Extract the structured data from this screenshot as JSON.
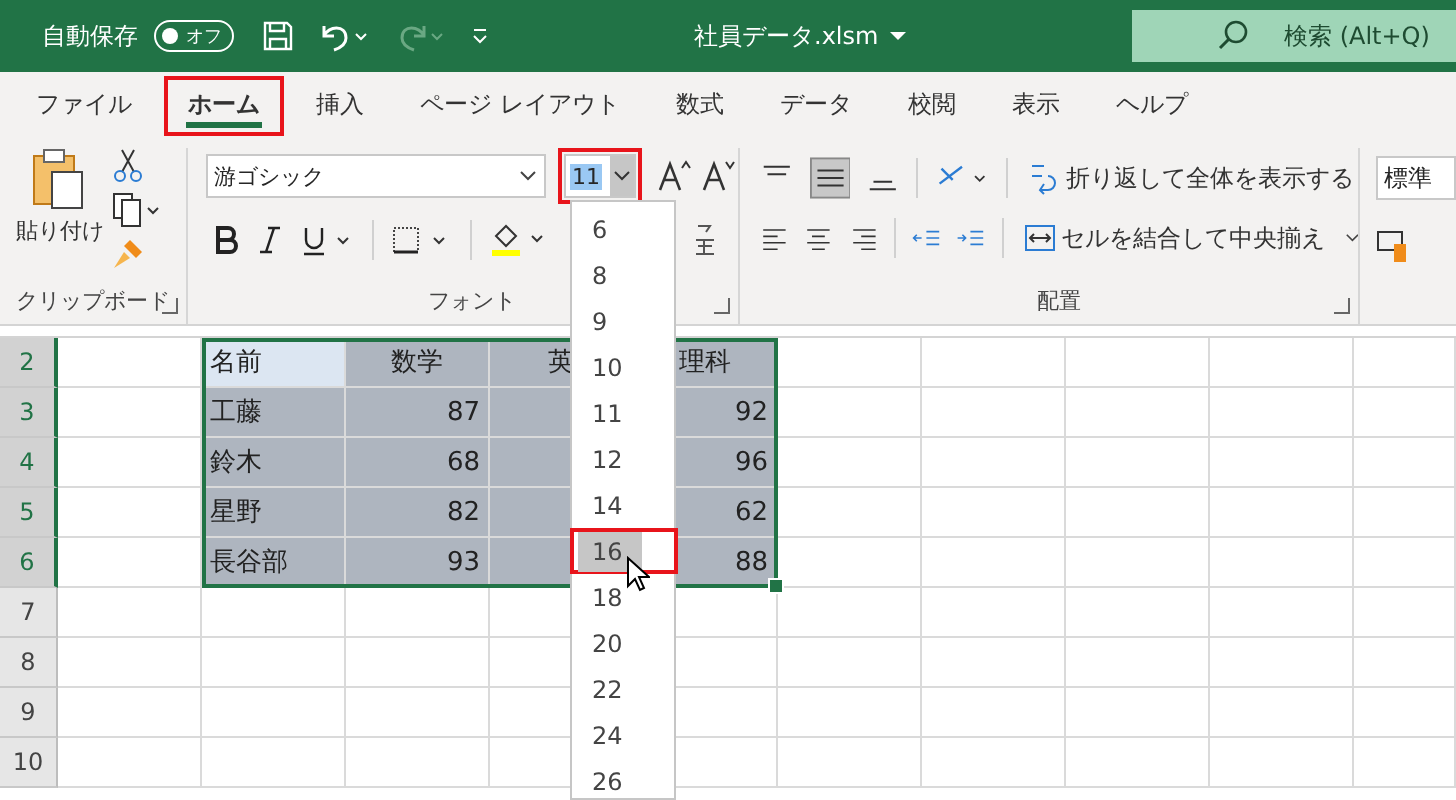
{
  "titlebar": {
    "autosave_label": "自動保存",
    "autosave_toggle": {
      "label": "オフ",
      "on": false
    },
    "filename": "社員データ.xlsm",
    "search_placeholder": "検索 (Alt+Q)"
  },
  "tabs": [
    {
      "label": "ファイル",
      "selected": false,
      "highlighted": false
    },
    {
      "label": "ホーム",
      "selected": true,
      "highlighted": true
    },
    {
      "label": "挿入",
      "selected": false,
      "highlighted": false
    },
    {
      "label": "ページ レイアウト",
      "selected": false,
      "highlighted": false
    },
    {
      "label": "数式",
      "selected": false,
      "highlighted": false
    },
    {
      "label": "データ",
      "selected": false,
      "highlighted": false
    },
    {
      "label": "校閲",
      "selected": false,
      "highlighted": false
    },
    {
      "label": "表示",
      "selected": false,
      "highlighted": false
    },
    {
      "label": "ヘルプ",
      "selected": false,
      "highlighted": false
    }
  ],
  "ribbon": {
    "clipboard": {
      "paste_label": "貼り付け",
      "group_label": "クリップボード"
    },
    "font": {
      "font_name": "游ゴシック",
      "font_size": "11",
      "size_highlighted": true,
      "group_label": "フォント"
    },
    "alignment": {
      "wrap_text": "折り返して全体を表示する",
      "merge_center": "セルを結合して中央揃え",
      "group_label": "配置"
    },
    "number": {
      "format": "標準"
    }
  },
  "font_size_dropdown": {
    "options": [
      {
        "label": "6",
        "selected": false
      },
      {
        "label": "8",
        "selected": false
      },
      {
        "label": "9",
        "selected": false
      },
      {
        "label": "10",
        "selected": false
      },
      {
        "label": "11",
        "selected": false
      },
      {
        "label": "12",
        "selected": false
      },
      {
        "label": "14",
        "selected": false
      },
      {
        "label": "16",
        "selected": true
      },
      {
        "label": "18",
        "selected": false
      },
      {
        "label": "20",
        "selected": false
      },
      {
        "label": "22",
        "selected": false
      },
      {
        "label": "24",
        "selected": false
      },
      {
        "label": "26",
        "selected": false
      }
    ]
  },
  "sheet": {
    "rows": [
      {
        "number": "2",
        "selected": true,
        "kind": "header",
        "name": "名前",
        "math": "数学",
        "english": "英",
        "science": "理科"
      },
      {
        "number": "3",
        "selected": true,
        "kind": "data",
        "name": "工藤",
        "math": "87",
        "science": "92"
      },
      {
        "number": "4",
        "selected": true,
        "kind": "data",
        "name": "鈴木",
        "math": "68",
        "science": "96"
      },
      {
        "number": "5",
        "selected": true,
        "kind": "data",
        "name": "星野",
        "math": "82",
        "science": "62"
      },
      {
        "number": "6",
        "selected": true,
        "kind": "data",
        "name": "長谷部",
        "math": "93",
        "science": "88"
      },
      {
        "number": "7",
        "selected": false,
        "kind": "empty"
      },
      {
        "number": "8",
        "selected": false,
        "kind": "empty"
      },
      {
        "number": "9",
        "selected": false,
        "kind": "empty"
      },
      {
        "number": "10",
        "selected": false,
        "kind": "empty"
      }
    ]
  }
}
